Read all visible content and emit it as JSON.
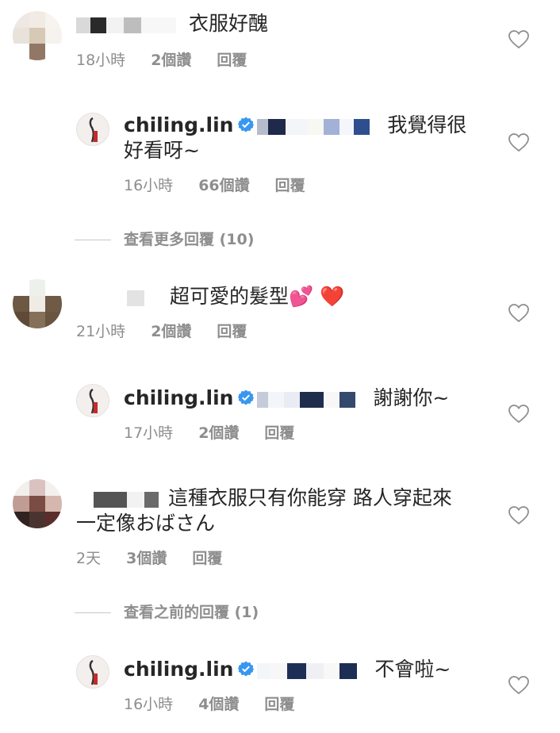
{
  "comments": [
    {
      "text": "衣服好醜",
      "meta": {
        "time": "18小時",
        "likes": "2個讚",
        "reply": "回覆"
      }
    },
    {
      "username": "chiling.lin",
      "text_line1": "我覺得很",
      "text_line2": "好看呀~",
      "meta": {
        "time": "16小時",
        "likes": "66個讚",
        "reply": "回覆"
      }
    },
    {
      "view_more": "查看更多回覆 (10)"
    },
    {
      "text": "超可愛的髮型💕 ❤️",
      "meta": {
        "time": "21小時",
        "likes": "2個讚",
        "reply": "回覆"
      }
    },
    {
      "username": "chiling.lin",
      "text": "謝謝你~",
      "meta": {
        "time": "17小時",
        "likes": "2個讚",
        "reply": "回覆"
      }
    },
    {
      "text_line1": "這種衣服只有你能穿 路人穿起來",
      "text_line2": "一定像おばさん",
      "meta": {
        "time": "2天",
        "likes": "3個讚",
        "reply": "回覆"
      }
    },
    {
      "view_more": "查看之前的回覆 (1)"
    },
    {
      "username": "chiling.lin",
      "text": "不會啦~",
      "meta": {
        "time": "16小時",
        "likes": "4個讚",
        "reply": "回覆"
      }
    }
  ],
  "colors": {
    "text": "#262626",
    "meta": "#8e8e8e",
    "verified": "#3897f0"
  },
  "icons": {
    "like": "heart-outline-icon",
    "verified": "verified-badge-icon"
  }
}
